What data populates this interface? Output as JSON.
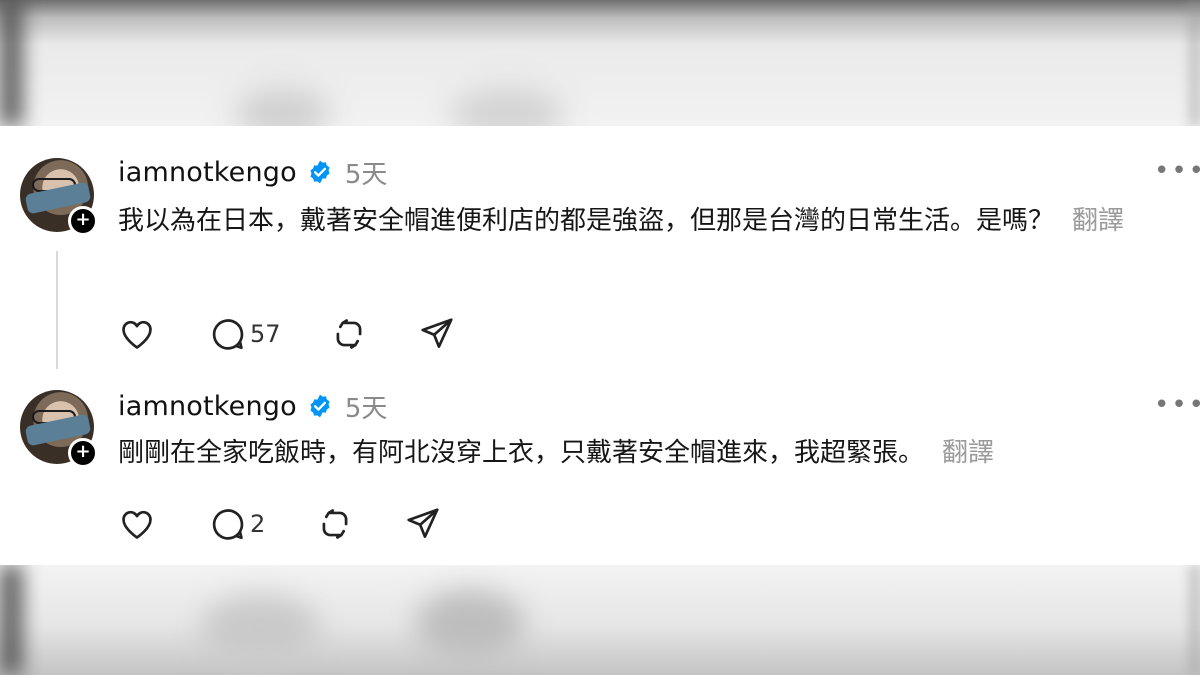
{
  "posts": [
    {
      "username": "iamnotkengo",
      "time": "5天",
      "text": "我以為在日本，戴著安全帽進便利店的都是強盜，但那是台灣的日常生活。是嗎？",
      "translate_label": "翻譯",
      "reply_count": "57",
      "more_icon": "more-horizontal-icon"
    },
    {
      "username": "iamnotkengo",
      "time": "5天",
      "text": "剛剛在全家吃飯時，有阿北沒穿上衣，只戴著安全帽進來，我超緊張。",
      "translate_label": "翻譯",
      "reply_count": "2",
      "more_icon": "more-horizontal-icon"
    }
  ],
  "colors": {
    "verified": "#0095f6",
    "muted": "#8a8a8a",
    "text": "#161616"
  },
  "icons": [
    "heart-icon",
    "comment-icon",
    "repost-icon",
    "share-icon",
    "verified-badge-icon",
    "follow-plus-icon"
  ]
}
